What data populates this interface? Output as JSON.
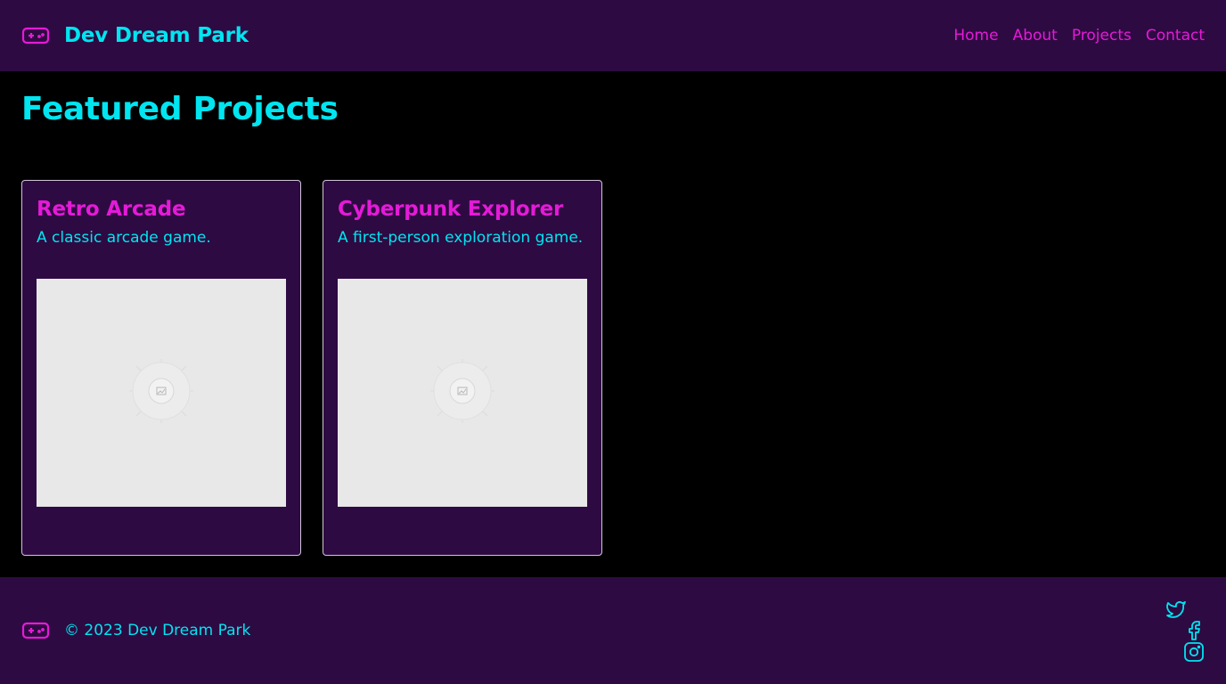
{
  "header": {
    "logo_icon": "gamepad-icon",
    "brand_title": "Dev Dream Park",
    "nav": [
      {
        "label": "Home"
      },
      {
        "label": "About"
      },
      {
        "label": "Projects"
      },
      {
        "label": "Contact"
      }
    ]
  },
  "main": {
    "title": "Featured Projects",
    "projects": [
      {
        "title": "Retro Arcade",
        "description": "A classic arcade game.",
        "image_icon": "image-placeholder-icon"
      },
      {
        "title": "Cyberpunk Explorer",
        "description": "A first-person exploration game.",
        "image_icon": "image-placeholder-icon"
      }
    ]
  },
  "footer": {
    "logo_icon": "gamepad-icon",
    "copyright": "© 2023 Dev Dream Park",
    "social": [
      {
        "icon": "twitter-icon"
      },
      {
        "icon": "facebook-icon"
      },
      {
        "icon": "instagram-icon"
      }
    ]
  },
  "colors": {
    "header_bg": "#2e0a42",
    "page_bg": "#000000",
    "accent_cyan": "#00e5f0",
    "accent_magenta": "#e51ad8",
    "card_border": "#cfc6d8",
    "image_placeholder": "#e8e8e8"
  }
}
